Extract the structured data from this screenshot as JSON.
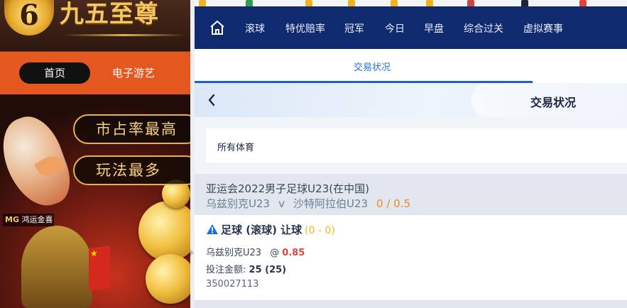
{
  "promo": {
    "logo_glyph": "6",
    "logo_text": "九五至尊",
    "nav_home": "首页",
    "nav_egame": "电子游艺",
    "slogan_1": "市占率最高",
    "slogan_2": "玩法最多",
    "mg_badge_prefix": "MG",
    "mg_badge_text": "鸿运金喜"
  },
  "topnav": {
    "tabs": [
      "滚球",
      "特优赔率",
      "冠军",
      "今日",
      "早盘",
      "综合过关",
      "虚拟赛事"
    ]
  },
  "subtab": {
    "label": "交易状况"
  },
  "status_header": {
    "title": "交易状况"
  },
  "filter": {
    "label": "所有体育"
  },
  "match": {
    "league": "亚运会2022男子足球U23(在中国)",
    "home": "乌兹别克U23",
    "vs": "v",
    "away": "沙特阿拉伯U23",
    "handicap": "0 / 0.5"
  },
  "bet": {
    "title": "足球 (滚球) 让球",
    "score": "(0 - 0)",
    "selection": "乌兹别克U23",
    "at": "@",
    "odds": "0.85",
    "amount_label": "投注金额:",
    "amount_value": "25 (25)",
    "ticket_id": "350027113"
  },
  "colors": {
    "nav_bg": "#0f2a6e",
    "accent_blue": "#1d5fcf",
    "handicap_orange": "#f08a24",
    "odds_red": "#e0453a",
    "score_yellow": "#f2b21e",
    "promo_orange": "#e4571e"
  }
}
